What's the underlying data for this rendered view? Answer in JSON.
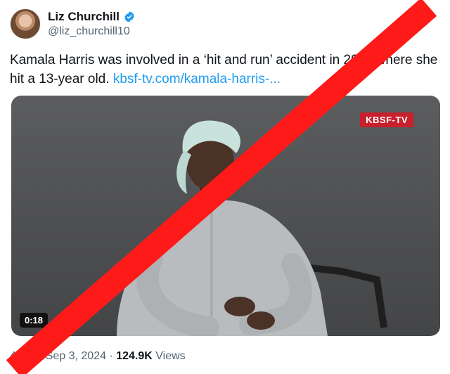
{
  "author": {
    "name": "Liz Churchill",
    "handle": "@liz_churchill10",
    "verified_icon": "verified-badge-icon"
  },
  "tweet": {
    "text": "Kamala Harris was involved in a ‘hit and run’ accident in 2011 where she hit a 13-year old.",
    "link": "kbsf-tv.com/kamala-harris-..."
  },
  "media": {
    "badge": "KBSF-TV",
    "duration": "0:18"
  },
  "meta": {
    "time": "4 AM",
    "date": "Sep 3, 2024",
    "views_count": "124.9K",
    "views_label": "Views"
  },
  "colors": {
    "link": "#1d9bf0",
    "strike": "#ff1a1a",
    "badge": "#c8202c"
  }
}
